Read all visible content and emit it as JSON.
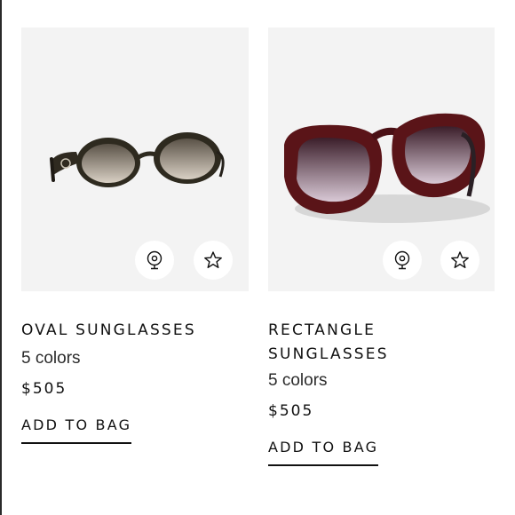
{
  "products": [
    {
      "name": "OVAL SUNGLASSES",
      "colors": "5 colors",
      "price": "$505",
      "add_to_bag": "ADD TO BAG",
      "icons": [
        "try-on-icon",
        "star-icon"
      ]
    },
    {
      "name": "RECTANGLE SUNGLASSES",
      "colors": "5 colors",
      "price": "$505",
      "add_to_bag": "ADD TO BAG",
      "icons": [
        "try-on-icon",
        "star-icon"
      ]
    }
  ]
}
